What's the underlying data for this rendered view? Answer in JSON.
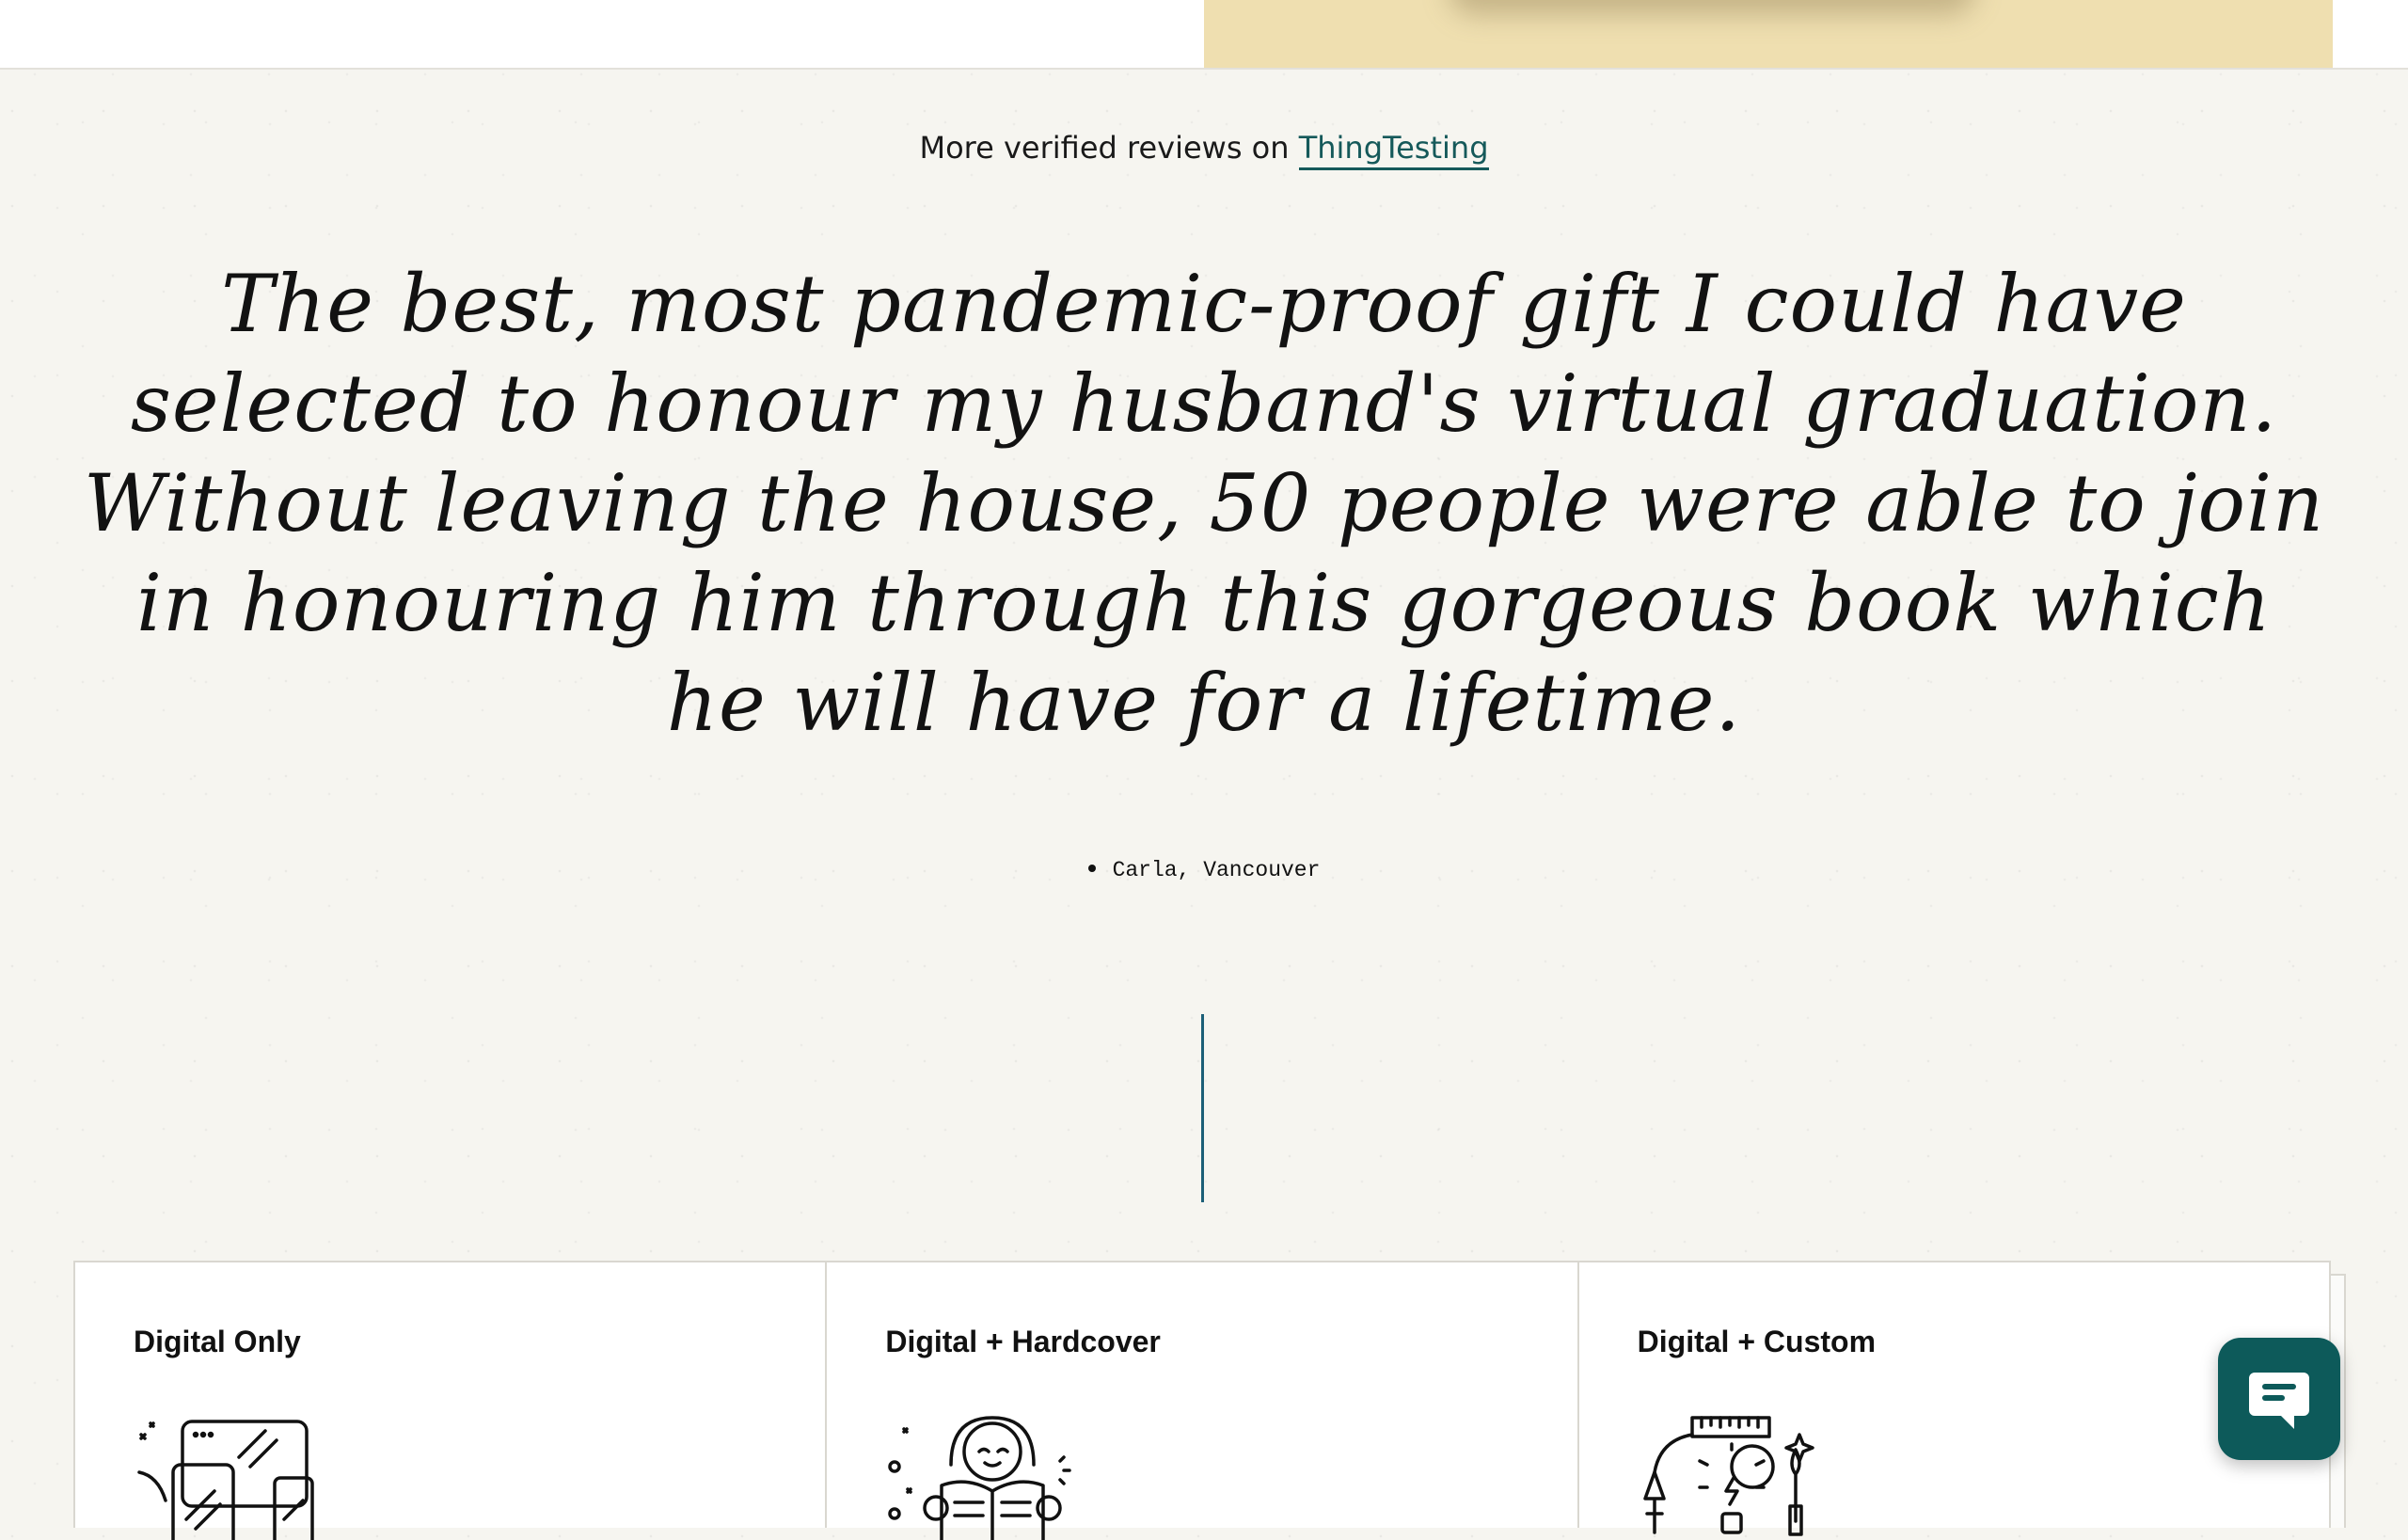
{
  "verified": {
    "prefix": "More verified reviews on",
    "link_label": "ThingTesting"
  },
  "testimonial": {
    "quote": "The best, most pandemic-proof gift I could have selected to honour my husband's virtual graduation. Without leaving the house, 50 people were able to join in honouring him through this gorgeous book which he will have for a lifetime.",
    "author": "Carla, Vancouver"
  },
  "plans": [
    {
      "title": "Digital Only",
      "icon": "devices-icon"
    },
    {
      "title": "Digital + Hardcover",
      "icon": "reading-person-icon"
    },
    {
      "title": "Digital + Custom",
      "icon": "creative-tools-icon"
    }
  ],
  "chat": {
    "icon": "chat-icon"
  },
  "colors": {
    "accent": "#15595a",
    "divider": "#1c5f78",
    "chat_button": "#0d5a5a",
    "banner": "#efdfb0",
    "background": "#f6f5f0"
  }
}
